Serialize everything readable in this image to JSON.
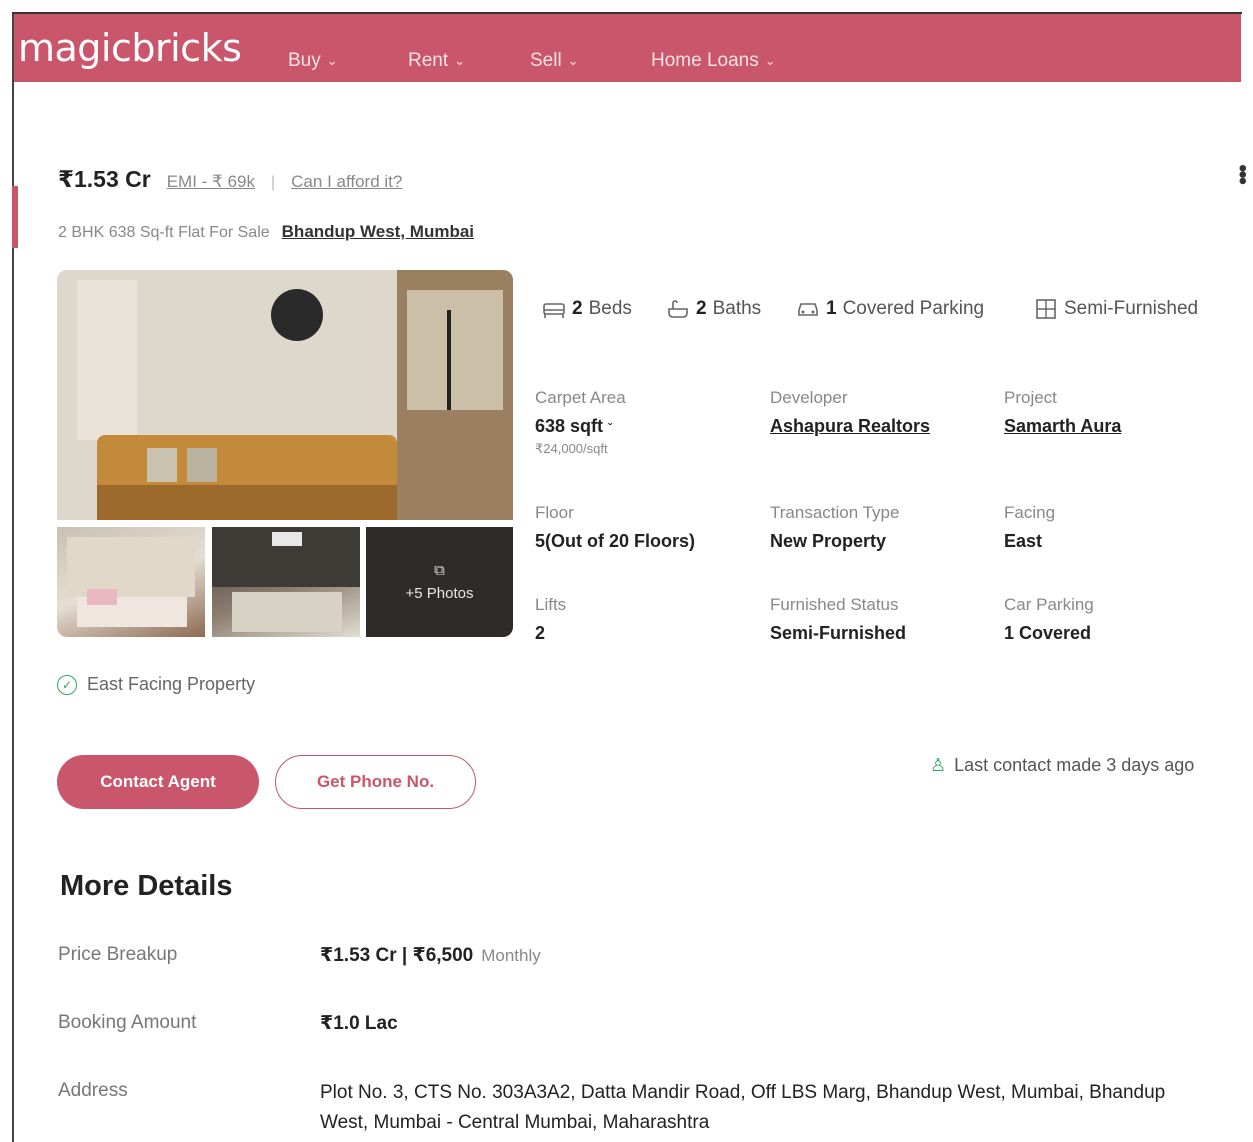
{
  "nav": {
    "logo": "magicbricks",
    "items": [
      {
        "label": "Buy"
      },
      {
        "label": "Rent"
      },
      {
        "label": "Sell"
      },
      {
        "label": "Home Loans"
      }
    ]
  },
  "listing": {
    "price": "₹1.53 Cr",
    "emi": "EMI - ₹ 69k",
    "separator": "|",
    "afford": "Can I afford it?",
    "subtitle": "2 BHK 638 Sq-ft Flat For Sale",
    "locality": "Bhandup West, Mumbai",
    "more_photos": "+5 Photos",
    "facing_note": "East Facing Property"
  },
  "amenities": [
    {
      "count": "2",
      "label": "Beds",
      "icon": "bed-icon"
    },
    {
      "count": "2",
      "label": "Baths",
      "icon": "bath-icon"
    },
    {
      "count": "1",
      "label": "Covered Parking",
      "icon": "car-icon"
    },
    {
      "count": "",
      "label": "Semi-Furnished",
      "icon": "furniture-icon"
    }
  ],
  "specs": {
    "carpet_area": {
      "label": "Carpet Area",
      "value": "638 sqft",
      "sub": "₹24,000/sqft"
    },
    "developer": {
      "label": "Developer",
      "value": "Ashapura Realtors"
    },
    "project": {
      "label": "Project",
      "value": "Samarth Aura"
    },
    "floor": {
      "label": "Floor",
      "value": "5(Out of 20 Floors)"
    },
    "transaction": {
      "label": "Transaction Type",
      "value": "New Property"
    },
    "facing": {
      "label": "Facing",
      "value": "East"
    },
    "lifts": {
      "label": "Lifts",
      "value": "2"
    },
    "furnished": {
      "label": "Furnished Status",
      "value": "Semi-Furnished"
    },
    "car_parking": {
      "label": "Car Parking",
      "value": "1 Covered"
    }
  },
  "actions": {
    "contact_agent": "Contact Agent",
    "get_phone": "Get Phone No.",
    "last_contact": "Last contact made 3 days ago"
  },
  "more_details": {
    "title": "More Details",
    "price_breakup_label": "Price Breakup",
    "price_breakup_value": "₹1.53 Cr | ₹6,500",
    "price_breakup_suffix": "Monthly",
    "booking_label": "Booking Amount",
    "booking_value": "₹1.0 Lac",
    "address_label": "Address",
    "address_value": "Plot No. 3, CTS No. 303A3A2, Datta Mandir Road, Off LBS Marg, Bhandup West, Mumbai, Bhandup West, Mumbai - Central Mumbai, Maharashtra"
  },
  "colors": {
    "brand": "#c9566a",
    "success": "#2eaa62"
  }
}
